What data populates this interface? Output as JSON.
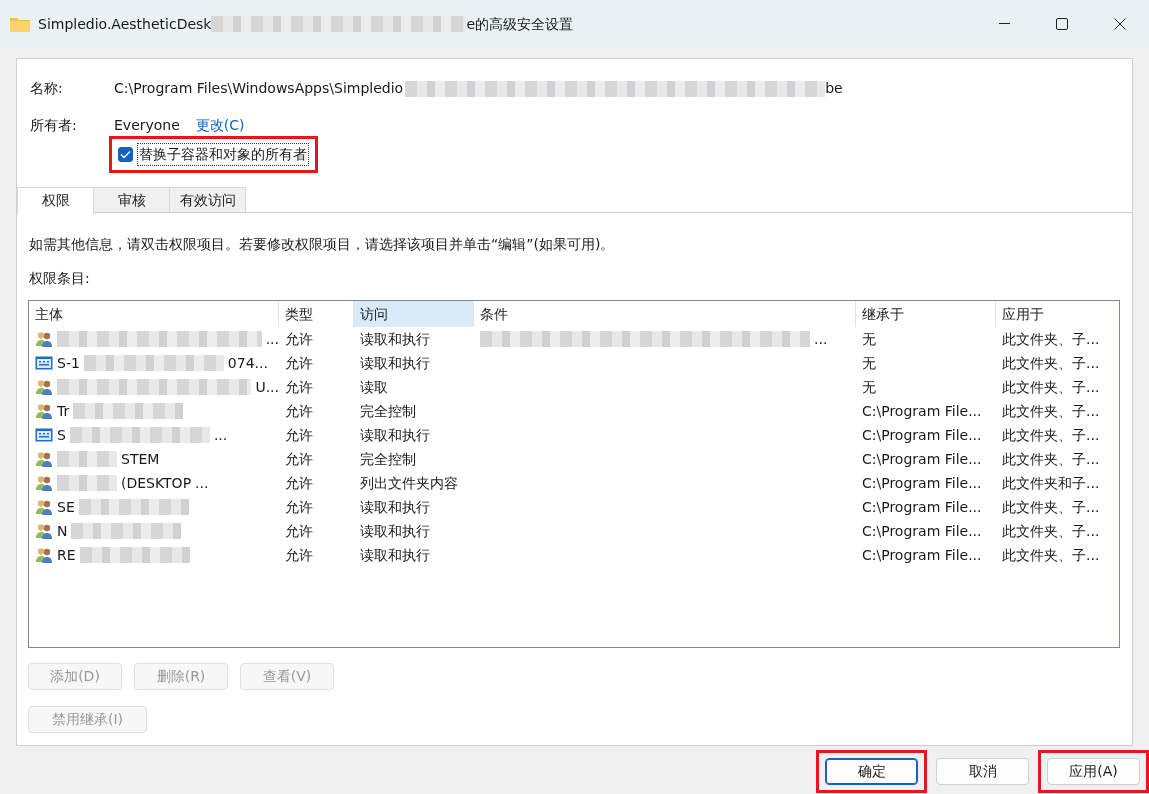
{
  "window": {
    "title_start": "Simpledio.AestheticDesk",
    "title_end": "e的高级安全设置"
  },
  "name": {
    "label": "名称:",
    "value_start": "C:\\Program Files\\WindowsApps\\Simpledio",
    "value_end": "be"
  },
  "owner": {
    "label": "所有者:",
    "value": "Everyone",
    "change_link": "更改(C)"
  },
  "replace_owner": {
    "label": "替换子容器和对象的所有者",
    "checked": true,
    "highlighted": true
  },
  "tabs": [
    {
      "label": "权限",
      "selected": true
    },
    {
      "label": "审核",
      "selected": false
    },
    {
      "label": "有效访问",
      "selected": false
    }
  ],
  "info": "如需其他信息，请双击权限项目。若要修改权限项目，请选择该项目并单击“编辑”(如果可用)。",
  "entries_label": "权限条目:",
  "table": {
    "columns": [
      {
        "label": "主体",
        "selected": false
      },
      {
        "label": "类型",
        "selected": false
      },
      {
        "label": "访问",
        "selected": true
      },
      {
        "label": "条件",
        "selected": false
      },
      {
        "label": "继承于",
        "selected": false
      },
      {
        "label": "应用于",
        "selected": false
      }
    ],
    "rows": [
      {
        "kind": "group",
        "masked_start": true,
        "masked_end": false,
        "principal_tail": "...",
        "type": "允许",
        "access": "读取和执行",
        "condition": "...",
        "inherited_from": "无",
        "applies_to": "此文件夹、子..."
      },
      {
        "kind": "sid",
        "masked_start": false,
        "masked_end": true,
        "principal": "S-1",
        "principal_tail": "074...",
        "type": "允许",
        "access": "读取和执行",
        "inherited_from": "无",
        "applies_to": "此文件夹、子..."
      },
      {
        "kind": "group",
        "masked_start": true,
        "masked_end": false,
        "principal_tail": "U...",
        "type": "允许",
        "access": "读取",
        "inherited_from": "无",
        "applies_to": "此文件夹、子..."
      },
      {
        "kind": "group",
        "masked_start": false,
        "masked_end": true,
        "principal": "Tr",
        "type": "允许",
        "access": "完全控制",
        "inherited_from": "C:\\Program File...",
        "applies_to": "此文件夹、子..."
      },
      {
        "kind": "sid",
        "masked_start": false,
        "masked_end": true,
        "principal": "S",
        "principal_tail": "...",
        "type": "允许",
        "access": "读取和执行",
        "inherited_from": "C:\\Program File...",
        "applies_to": "此文件夹、子..."
      },
      {
        "kind": "group",
        "masked_start": true,
        "masked_end": false,
        "principal": "STEM",
        "type": "允许",
        "access": "完全控制",
        "inherited_from": "C:\\Program File...",
        "applies_to": "此文件夹、子..."
      },
      {
        "kind": "group",
        "masked_start": true,
        "masked_end": false,
        "principal": "(DESKTOP",
        "principal_tail": "...",
        "type": "允许",
        "access": "列出文件夹内容",
        "inherited_from": "C:\\Program File...",
        "applies_to": "此文件夹和子..."
      },
      {
        "kind": "group",
        "masked_start": false,
        "masked_end": true,
        "principal": "SE",
        "type": "允许",
        "access": "读取和执行",
        "inherited_from": "C:\\Program File...",
        "applies_to": "此文件夹、子..."
      },
      {
        "kind": "group",
        "masked_start": false,
        "masked_end": true,
        "principal": "N",
        "type": "允许",
        "access": "读取和执行",
        "inherited_from": "C:\\Program File...",
        "applies_to": "此文件夹、子..."
      },
      {
        "kind": "group",
        "masked_start": false,
        "masked_end": true,
        "principal": "RE",
        "type": "允许",
        "access": "读取和执行",
        "inherited_from": "C:\\Program File...",
        "applies_to": "此文件夹、子..."
      }
    ]
  },
  "entry_buttons": [
    {
      "label": "添加(D)",
      "disabled": true
    },
    {
      "label": "删除(R)",
      "disabled": true
    },
    {
      "label": "查看(V)",
      "disabled": true
    }
  ],
  "inheritance_button": {
    "label": "禁用继承(I)",
    "disabled": true
  },
  "footer_buttons": [
    {
      "label": "确定",
      "default": true,
      "highlighted": true
    },
    {
      "label": "取消",
      "default": false,
      "highlighted": false
    },
    {
      "label": "应用(A)",
      "default": false,
      "highlighted": true
    }
  ]
}
